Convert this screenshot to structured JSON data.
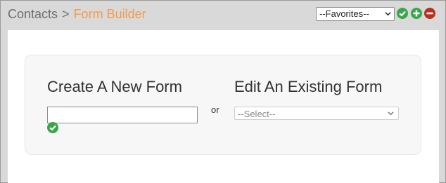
{
  "breadcrumb": {
    "section": "Contacts",
    "separator": ">",
    "current": "Form Builder"
  },
  "favorites": {
    "selected": "--Favorites--"
  },
  "header_icons": [
    "check-icon",
    "add-icon",
    "remove-icon"
  ],
  "create_form": {
    "title": "Create A New Form",
    "input_value": ""
  },
  "or_label": "or",
  "edit_form": {
    "title": "Edit An Existing Form",
    "selected": "--Select--"
  },
  "colors": {
    "accent": "#f59a4e",
    "green": "#3aa64a",
    "red": "#b8301f"
  }
}
